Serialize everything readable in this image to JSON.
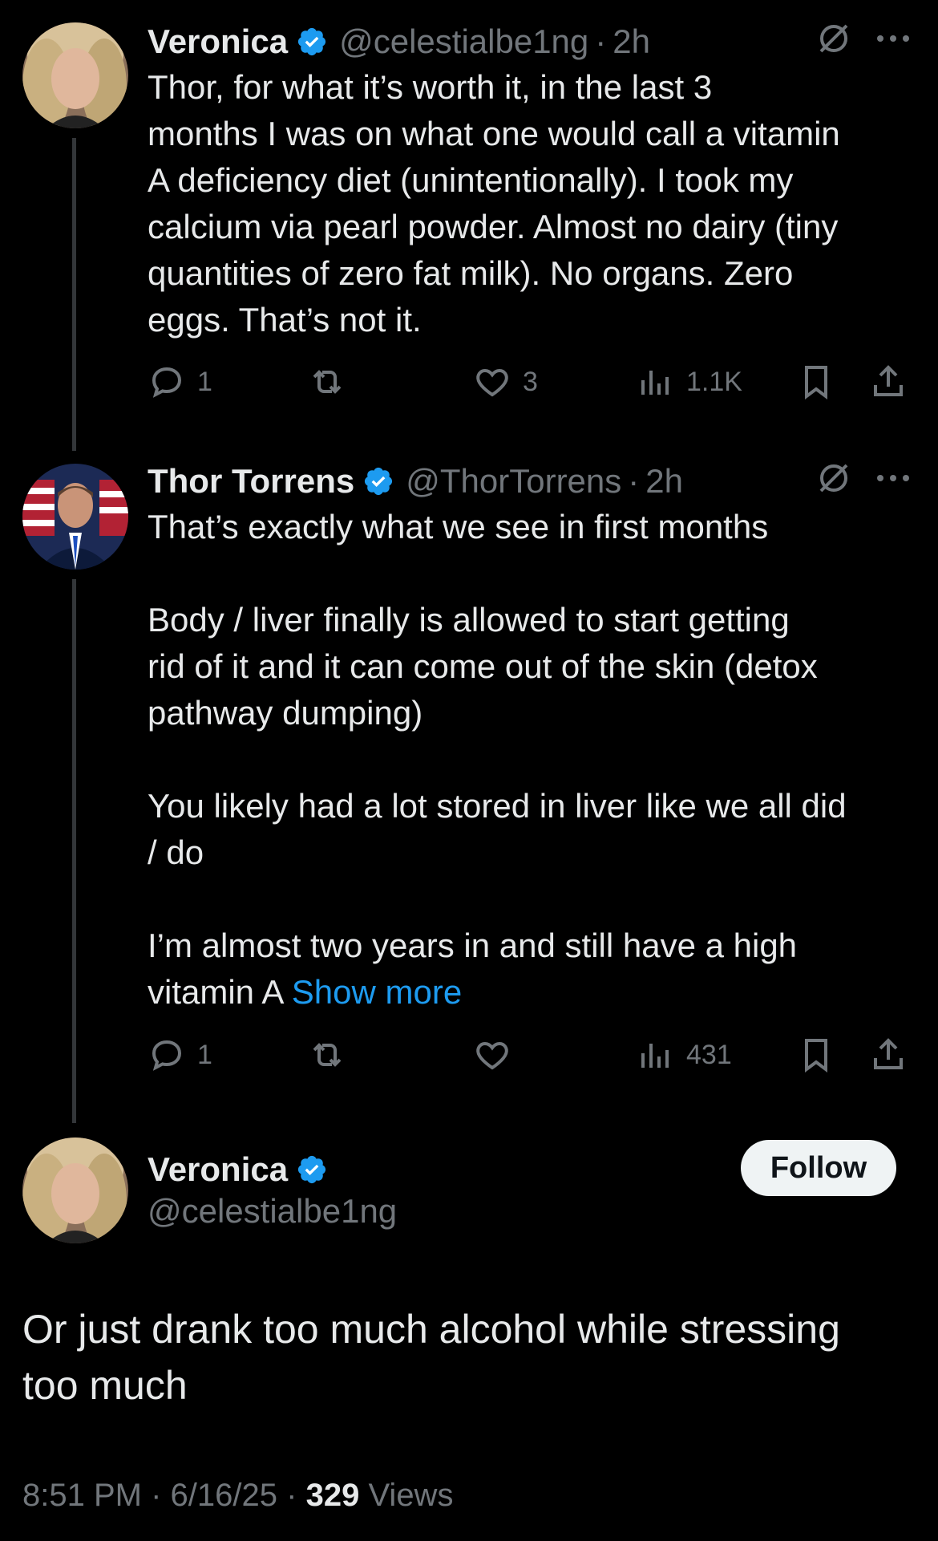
{
  "colors": {
    "background": "#000000",
    "text": "#e7e9ea",
    "muted": "#71767b",
    "link": "#1d9bf0",
    "verified": "#1d9bf0"
  },
  "tweets": [
    {
      "name": "Veronica",
      "handle": "@celestialbe1ng",
      "time": "2h",
      "text": "Thor, for what it’s worth it, in the last 3\nmonths I was on what one would call a vitamin\nA deficiency diet (unintentionally). I took my\ncalcium via pearl powder. Almost no dairy (tiny\nquantities of zero fat milk). No organs. Zero\neggs. That’s not it.",
      "replies": "1",
      "reposts": "",
      "likes": "3",
      "views": "1.1K"
    },
    {
      "name": "Thor Torrens",
      "handle": "@ThorTorrens",
      "time": "2h",
      "text": "That’s exactly what we see in first months\n\nBody / liver finally is allowed to start getting\nrid of it and it can come out of the skin (detox\npathway dumping)\n\nYou likely had a lot stored in liver like we all did\n/ do\n\nI’m almost two years in and still have a high\nvitamin A ",
      "show_more": "Show more",
      "replies": "1",
      "reposts": "",
      "likes": "",
      "views": "431"
    }
  ],
  "main_tweet": {
    "name": "Veronica",
    "handle": "@celestialbe1ng",
    "follow_label": "Follow",
    "text": "Or just drank too much alcohol while stressing too much",
    "time": "8:51 PM",
    "date": "6/16/25",
    "views_count": "329",
    "views_label": "Views",
    "dot": "·"
  },
  "icons": [
    "verified-badge-icon",
    "grok-icon",
    "more-icon",
    "reply-icon",
    "repost-icon",
    "like-icon",
    "views-icon",
    "bookmark-icon",
    "share-icon"
  ]
}
